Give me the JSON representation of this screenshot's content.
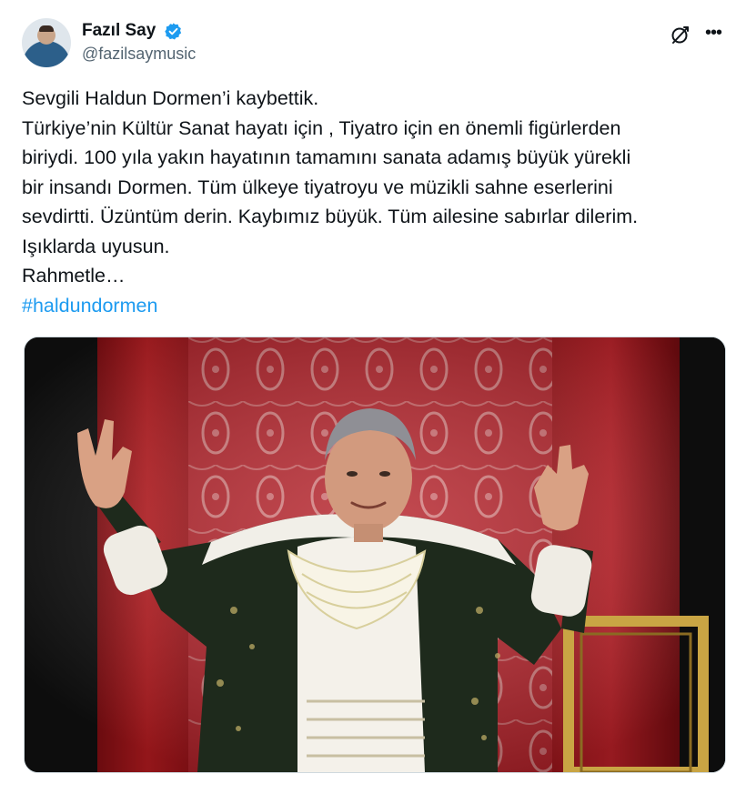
{
  "author": {
    "display_name": "Fazıl Say",
    "handle": "@fazilsaymusic",
    "verified": true,
    "avatar_icon": "avatar-photo"
  },
  "actions": {
    "grok_icon": "grok-icon",
    "more_icon": "more-icon"
  },
  "tweet": {
    "lines": [
      "Sevgili Haldun Dormen’i kaybettik.",
      "Türkiye’nin Kültür Sanat hayatı için , Tiyatro için en önemli figürlerden",
      "biriydi. 100 yıla yakın hayatının tamamını sanata adamış büyük yürekli",
      "bir insandı Dormen. Tüm ülkeye tiyatroyu ve müzikli sahne eserlerini",
      "sevdirtti. Üzüntüm derin.  Kaybımız büyük. Tüm ailesine sabırlar dilerim.",
      "Işıklarda uyusun.",
      "Rahmetle…"
    ],
    "hashtag": "#haldundormen"
  },
  "colors": {
    "link": "#1d9bf0",
    "verified_badge": "#1d9bf0",
    "secondary_text": "#536471",
    "stage_red": "#b3161d"
  }
}
